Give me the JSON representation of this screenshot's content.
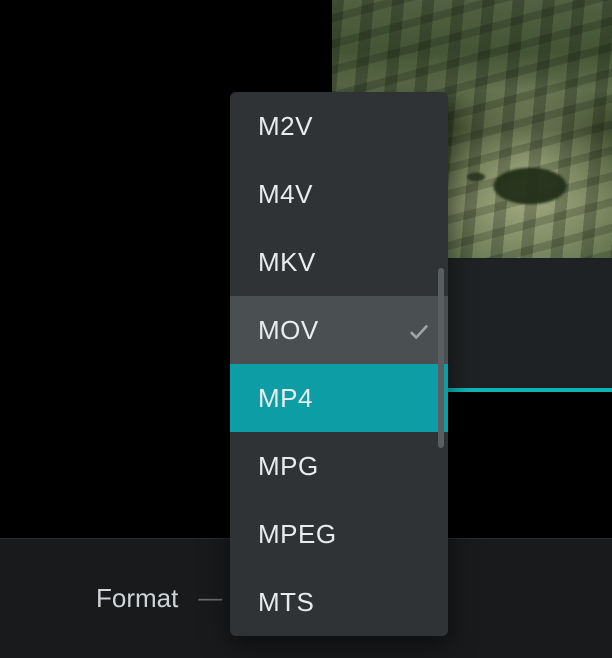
{
  "preview": {
    "description": "park-scene"
  },
  "bottom": {
    "format_label": "Format",
    "dash": "—"
  },
  "dropdown": {
    "items": [
      {
        "label": "M2V",
        "state": "normal"
      },
      {
        "label": "M4V",
        "state": "normal"
      },
      {
        "label": "MKV",
        "state": "normal"
      },
      {
        "label": "MOV",
        "state": "hover-checked"
      },
      {
        "label": "MP4",
        "state": "selected"
      },
      {
        "label": "MPG",
        "state": "normal"
      },
      {
        "label": "MPEG",
        "state": "normal"
      },
      {
        "label": "MTS",
        "state": "normal"
      }
    ],
    "selected_value": "MP4",
    "hovered_value": "MOV"
  },
  "colors": {
    "accent": "#0d9da5",
    "panel": "#2f3336",
    "hover": "#4a4f52"
  }
}
